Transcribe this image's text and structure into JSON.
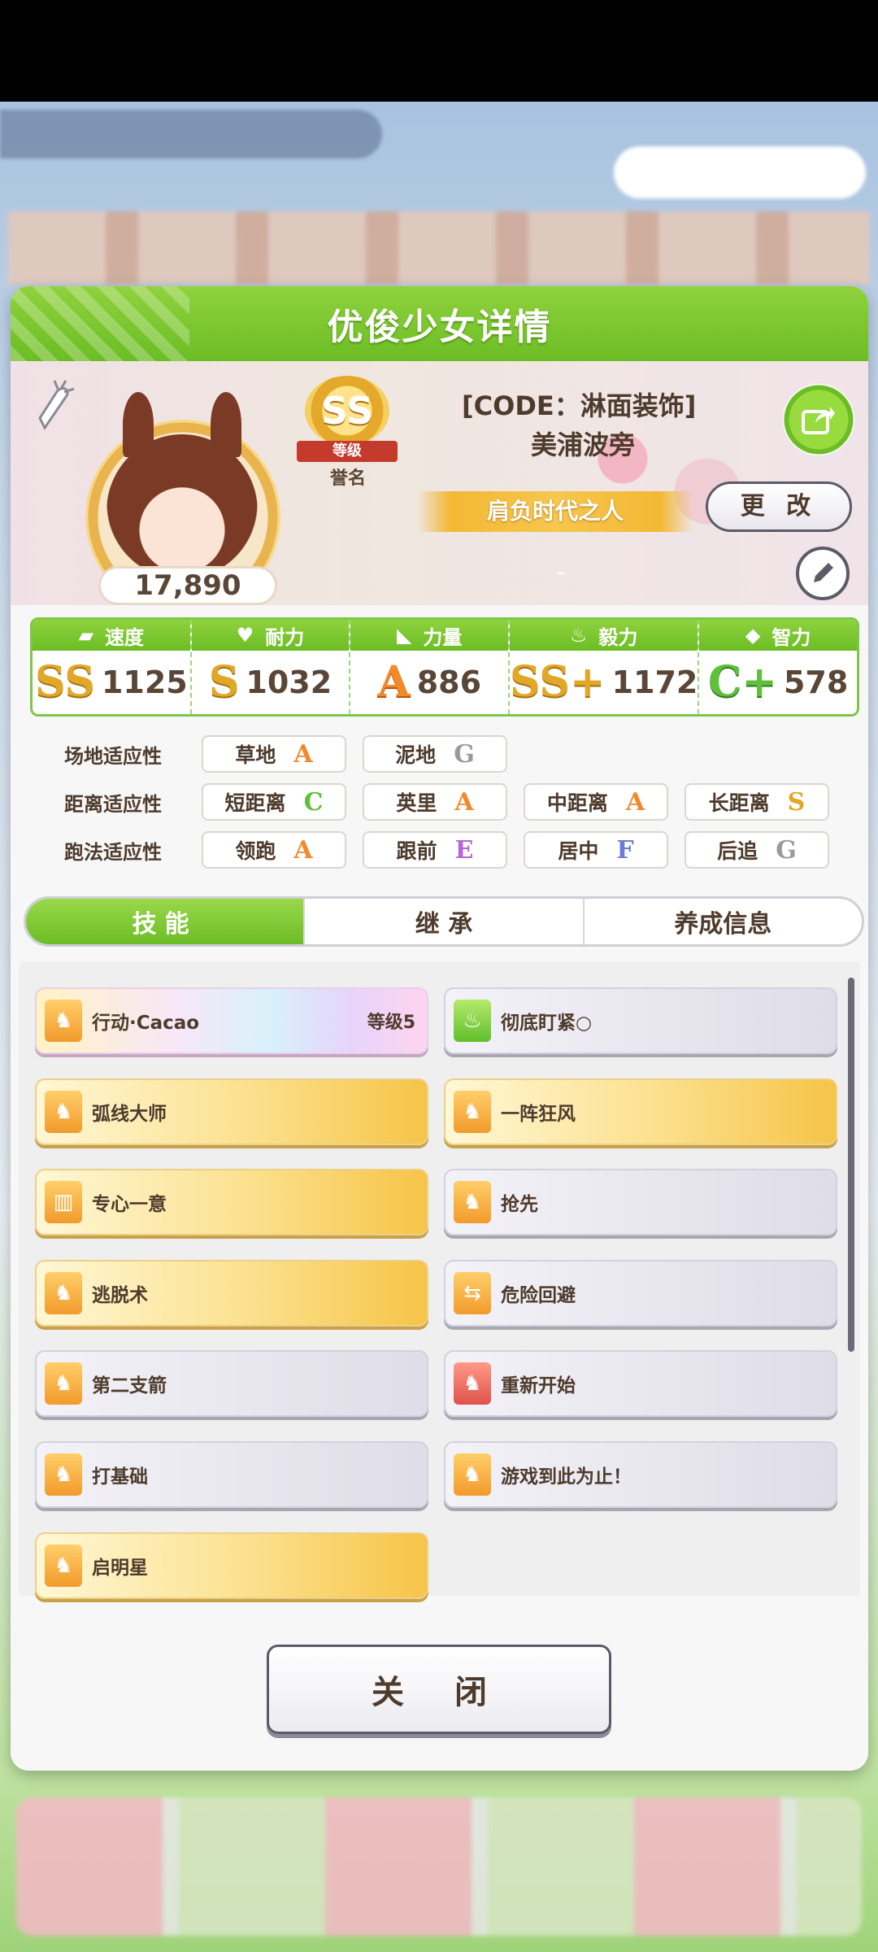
{
  "modal": {
    "title": "优俊少女详情"
  },
  "profile": {
    "rating": "17,890",
    "rank_grade": "SS",
    "rank_ribbon": "等级",
    "rank_sub": "誉名",
    "code_line": "[CODE：淋面装饰]",
    "name": "美浦波旁",
    "title": "肩负时代之人",
    "dash": "-",
    "change_label": "更 改"
  },
  "stats": [
    {
      "label": "速度",
      "icon": "shoe-icon",
      "grade": "SS",
      "value": "1125"
    },
    {
      "label": "耐力",
      "icon": "heart-icon",
      "grade": "S",
      "value": "1032"
    },
    {
      "label": "力量",
      "icon": "muscle-icon",
      "grade": "A",
      "value": "886"
    },
    {
      "label": "毅力",
      "icon": "flame-icon",
      "grade": "SS+",
      "value": "1172"
    },
    {
      "label": "智力",
      "icon": "graduation-cap-icon",
      "grade": "C+",
      "value": "578"
    }
  ],
  "aptitudes": {
    "track": {
      "label": "场地适应性",
      "items": [
        {
          "name": "草地",
          "grade": "A"
        },
        {
          "name": "泥地",
          "grade": "G"
        }
      ]
    },
    "distance": {
      "label": "距离适应性",
      "items": [
        {
          "name": "短距离",
          "grade": "C"
        },
        {
          "name": "英里",
          "grade": "A"
        },
        {
          "name": "中距离",
          "grade": "A"
        },
        {
          "name": "长距离",
          "grade": "S"
        }
      ]
    },
    "style": {
      "label": "跑法适应性",
      "items": [
        {
          "name": "领跑",
          "grade": "A"
        },
        {
          "name": "跟前",
          "grade": "E"
        },
        {
          "name": "居中",
          "grade": "F"
        },
        {
          "name": "后追",
          "grade": "G"
        }
      ]
    }
  },
  "tabs": [
    {
      "label": "技能"
    },
    {
      "label": "继 承"
    },
    {
      "label": "养成信息"
    }
  ],
  "skills": [
    {
      "name": "行动·Cacao",
      "level": "等级5",
      "style": "rainbow",
      "icon": "running-horse-icon"
    },
    {
      "name": "彻底盯紧○",
      "level": "",
      "style": "plain",
      "icon": "green-flame-icon"
    },
    {
      "name": "弧线大师",
      "level": "",
      "style": "gold",
      "icon": "running-horse-icon"
    },
    {
      "name": "一阵狂风",
      "level": "",
      "style": "gold",
      "icon": "running-horse-icon"
    },
    {
      "name": "专心一意",
      "level": "",
      "style": "gold",
      "icon": "gate-icon"
    },
    {
      "name": "抢先",
      "level": "",
      "style": "plain",
      "icon": "running-horse-icon"
    },
    {
      "name": "逃脱术",
      "level": "",
      "style": "gold",
      "icon": "running-horse-icon"
    },
    {
      "name": "危险回避",
      "level": "",
      "style": "plain",
      "icon": "arrows-icon"
    },
    {
      "name": "第二支箭",
      "level": "",
      "style": "plain",
      "icon": "running-horse-icon"
    },
    {
      "name": "重新开始",
      "level": "",
      "style": "plain",
      "icon": "red-horse-icon"
    },
    {
      "name": "打基础",
      "level": "",
      "style": "plain",
      "icon": "running-horse-icon"
    },
    {
      "name": "游戏到此为止！",
      "level": "",
      "style": "plain",
      "icon": "running-horse-icon"
    },
    {
      "name": "启明星",
      "level": "",
      "style": "gold",
      "icon": "running-horse-icon"
    }
  ],
  "close_label": "关 闭"
}
